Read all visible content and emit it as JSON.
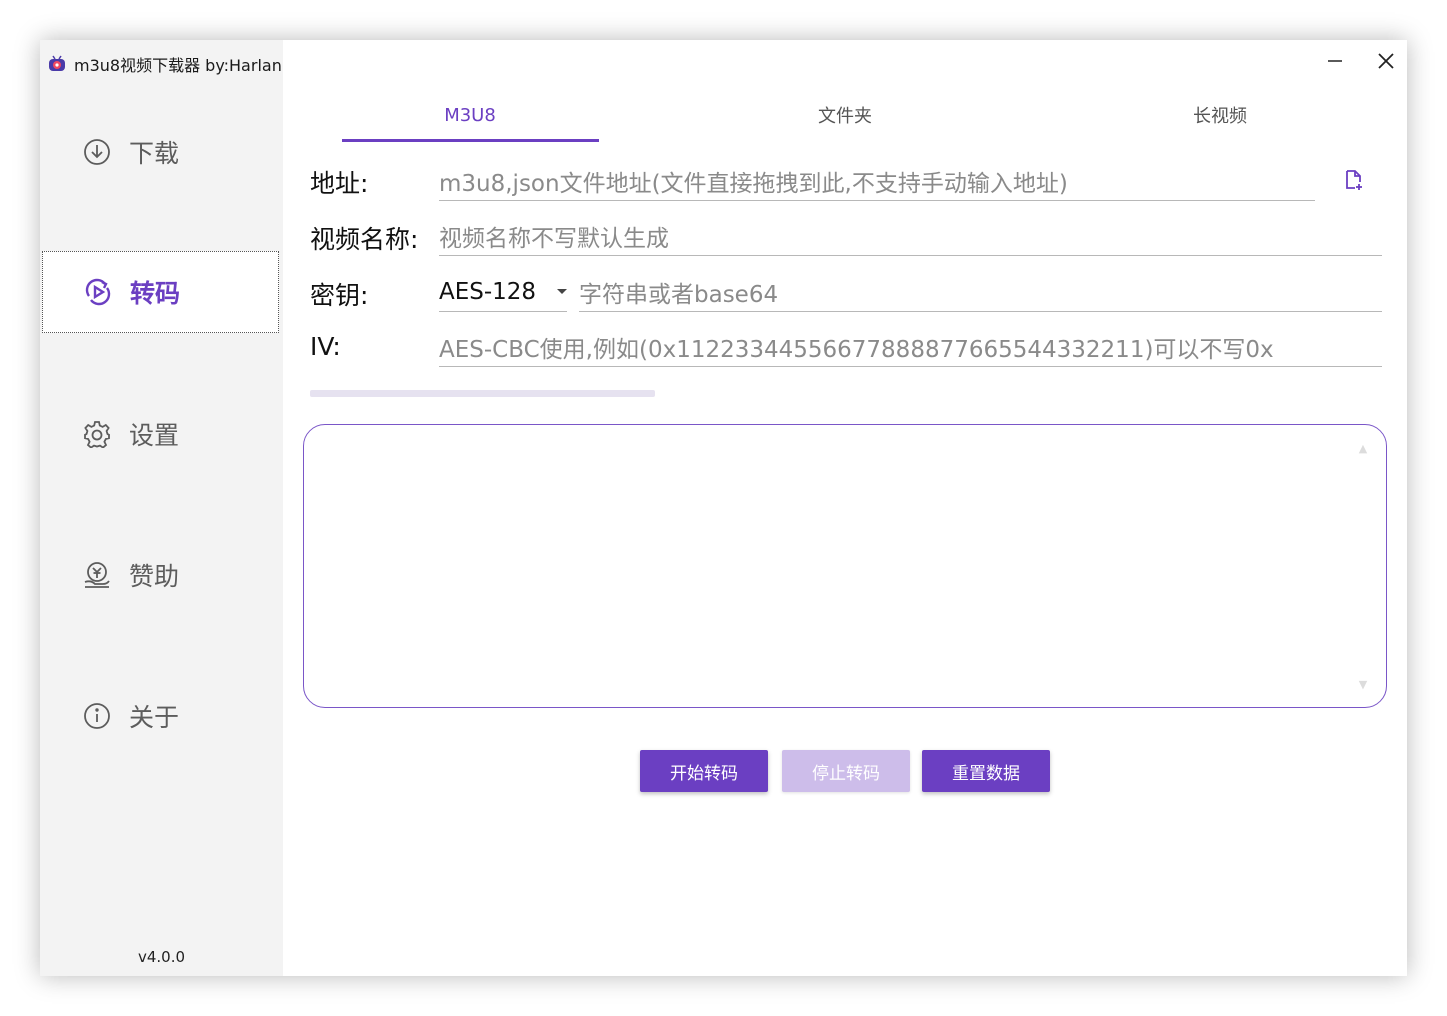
{
  "app": {
    "title": "m3u8视频下载器 by:Harlan",
    "version": "v4.0.0"
  },
  "window_controls": {
    "minimize": "—",
    "close": "✕"
  },
  "sidebar": {
    "items": [
      {
        "label": "下载",
        "icon": "download-circle-icon",
        "active": false
      },
      {
        "label": "转码",
        "icon": "transcode-icon",
        "active": true
      },
      {
        "label": "设置",
        "icon": "gear-icon",
        "active": false
      },
      {
        "label": "赞助",
        "icon": "sponsor-icon",
        "active": false
      },
      {
        "label": "关于",
        "icon": "info-icon",
        "active": false
      }
    ]
  },
  "tabs": [
    {
      "label": "M3U8",
      "active": true
    },
    {
      "label": "文件夹",
      "active": false
    },
    {
      "label": "长视频",
      "active": false
    }
  ],
  "form": {
    "address": {
      "label": "地址:",
      "value": "",
      "placeholder": "m3u8,json文件地址(文件直接拖拽到此,不支持手动输入地址)"
    },
    "video_name": {
      "label": "视频名称:",
      "value": "",
      "placeholder": "视频名称不写默认生成"
    },
    "key": {
      "label": "密钥:",
      "method": "AES-128",
      "value": "",
      "placeholder": "字符串或者base64"
    },
    "iv": {
      "label": "IV:",
      "value": "",
      "placeholder": "AES-CBC使用,例如(0x11223344556677888877665544332211)可以不写0x"
    }
  },
  "progress": {
    "value": 0
  },
  "log": {
    "text": ""
  },
  "buttons": {
    "start": "开始转码",
    "stop": "停止转码",
    "reset": "重置数据"
  },
  "colors": {
    "accent": "#6b3fc2",
    "accent_disabled": "#cdbdea",
    "sidebar_bg": "#f3f3f3"
  }
}
